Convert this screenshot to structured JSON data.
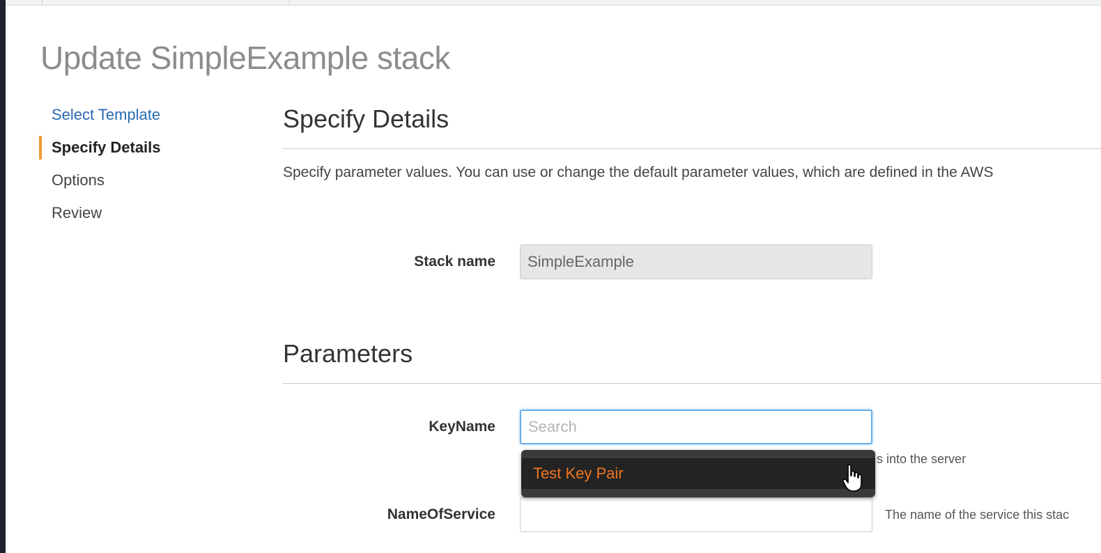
{
  "page": {
    "title": "Update SimpleExample stack"
  },
  "steps": [
    {
      "label": "Select Template",
      "state": "link"
    },
    {
      "label": "Specify Details",
      "state": "active"
    },
    {
      "label": "Options",
      "state": "pending"
    },
    {
      "label": "Review",
      "state": "pending"
    }
  ],
  "details": {
    "heading": "Specify Details",
    "description": "Specify parameter values. You can use or change the default parameter values, which are defined in the AWS"
  },
  "stack_name": {
    "label": "Stack name",
    "value": "SimpleExample"
  },
  "parameters": {
    "heading": "Parameters",
    "key_name": {
      "label": "KeyName",
      "placeholder": "Search",
      "hint": "s into the server",
      "dropdown_option": "Test Key Pair"
    },
    "name_of_service": {
      "label": "NameOfService",
      "value": "",
      "hint": "The name of the service this stac"
    }
  },
  "colors": {
    "active_step_bar": "#f29a32",
    "link": "#2a6ab3",
    "dropdown_option_text": "#f0761e",
    "focus_border": "#66afe9"
  },
  "icons": {
    "cursor": "hand-pointer-icon"
  }
}
